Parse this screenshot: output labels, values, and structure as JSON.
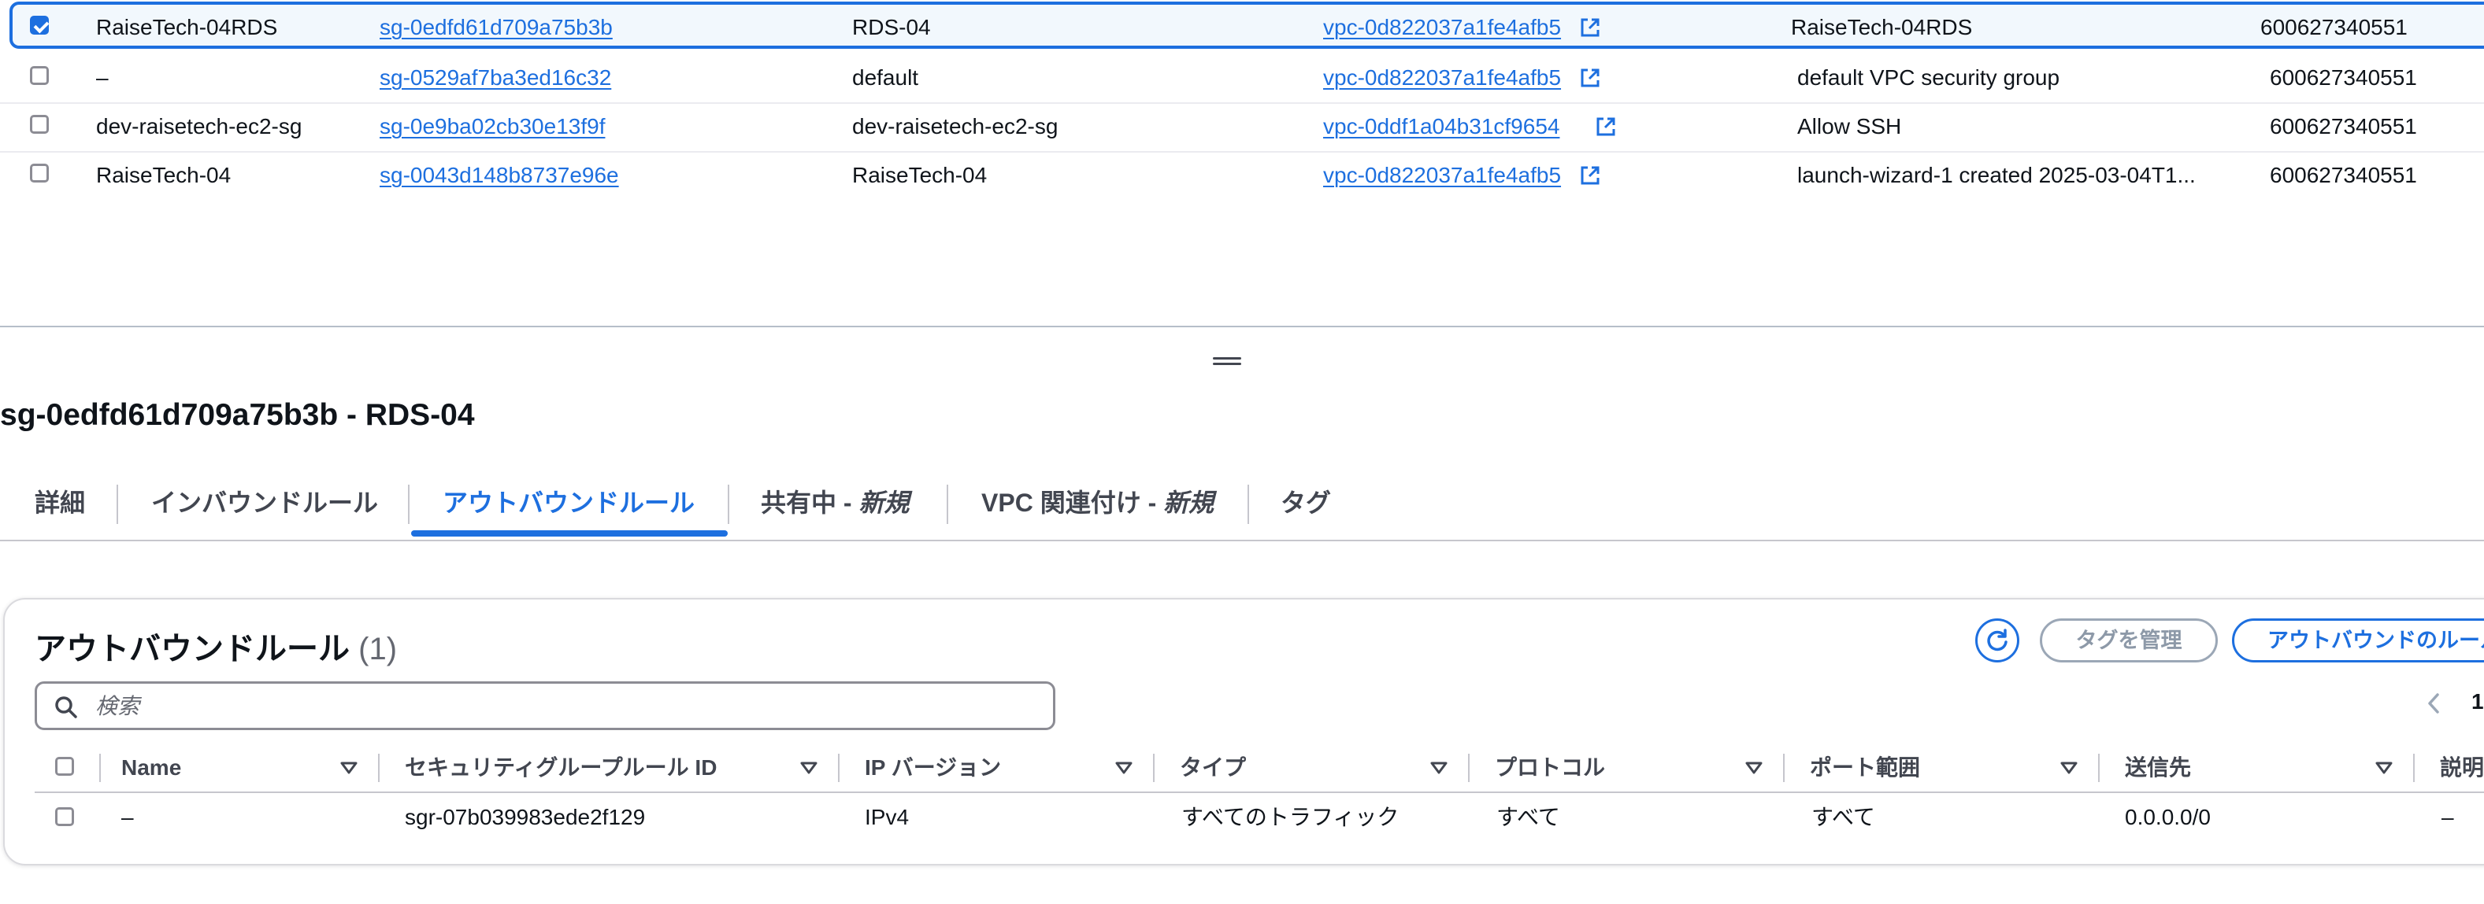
{
  "sg_table": {
    "rows": [
      {
        "name": "RaiseTech-04RDS",
        "sg_id": "sg-0edfd61d709a75b3b",
        "group_name": "RDS-04",
        "vpc_id": "vpc-0d822037a1fe4afb5",
        "description": "RaiseTech-04RDS",
        "owner": "600627340551",
        "selected": true
      },
      {
        "name": "–",
        "sg_id": "sg-0529af7ba3ed16c32",
        "group_name": "default",
        "vpc_id": "vpc-0d822037a1fe4afb5",
        "description": "default VPC security group",
        "owner": "600627340551",
        "selected": false
      },
      {
        "name": "dev-raisetech-ec2-sg",
        "sg_id": "sg-0e9ba02cb30e13f9f",
        "group_name": "dev-raisetech-ec2-sg",
        "vpc_id": "vpc-0ddf1a04b31cf9654",
        "description": "Allow SSH",
        "owner": "600627340551",
        "selected": false
      },
      {
        "name": "RaiseTech-04",
        "sg_id": "sg-0043d148b8737e96e",
        "group_name": "RaiseTech-04",
        "vpc_id": "vpc-0d822037a1fe4afb5",
        "description": "launch-wizard-1 created 2025-03-04T1...",
        "owner": "600627340551",
        "selected": false
      }
    ]
  },
  "detail": {
    "title": "sg-0edfd61d709a75b3b - RDS-04",
    "tabs": [
      {
        "label": "詳細",
        "suffix": ""
      },
      {
        "label": "インバウンドルール",
        "suffix": ""
      },
      {
        "label": "アウトバウンドルール",
        "suffix": ""
      },
      {
        "label": "共有中 - ",
        "suffix": "新規"
      },
      {
        "label": "VPC 関連付け - ",
        "suffix": "新規"
      },
      {
        "label": "タグ",
        "suffix": ""
      }
    ],
    "active_tab": "アウトバウンドルール"
  },
  "outbound": {
    "title": "アウトバウンドルール",
    "count": "(1)",
    "manage_tags_label": "タグを管理",
    "edit_label": "アウトバウンドのルールを編集",
    "search_placeholder": "検索",
    "page": "1",
    "columns": [
      "Name",
      "セキュリティグループルール ID",
      "IP バージョン",
      "タイプ",
      "プロトコル",
      "ポート範囲",
      "送信先",
      "説明"
    ],
    "rows": [
      {
        "name": "–",
        "rule_id": "sgr-07b039983ede2f129",
        "ip_version": "IPv4",
        "type": "すべてのトラフィック",
        "protocol": "すべて",
        "port_range": "すべて",
        "destination": "0.0.0.0/0",
        "description": "–"
      }
    ]
  },
  "colors": {
    "accent": "#1d6fdf",
    "text": "#0f141a",
    "muted": "#424650"
  },
  "icons": [
    "external-link-icon",
    "refresh-icon",
    "search-icon",
    "chevron-left-icon",
    "sort-down-icon",
    "resize-grip-icon"
  ]
}
